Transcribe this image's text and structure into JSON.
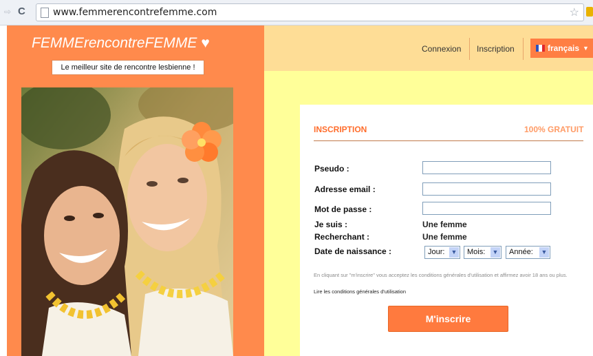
{
  "browser": {
    "url": "www.femmerencontrefemme.com",
    "star_icon": "star-icon",
    "reload_icon": "reload-icon"
  },
  "header": {
    "logo": "FEMMErencontreFEMME",
    "logo_heart": "♥",
    "tagline": "Le meilleur site de rencontre lesbienne !",
    "nav": {
      "login": "Connexion",
      "signup": "Inscription",
      "language": "français"
    }
  },
  "form": {
    "title": "INSCRIPTION",
    "badge": "100% GRATUIT",
    "fields": {
      "pseudo_label": "Pseudo :",
      "pseudo_value": "",
      "email_label": "Adresse email :",
      "email_value": "",
      "password_label": "Mot de passe :",
      "password_value": "",
      "iam_label": "Je suis :",
      "iam_value": "Une femme",
      "seeking_label": "Recherchant :",
      "seeking_value": "Une femme",
      "birthdate_label": "Date de naissance :",
      "day": "Jour:",
      "month": "Mois:",
      "year": "Année:"
    },
    "legal": "En cliquant sur \"m'inscrire\" vous acceptez les conditions générales d'utilisation et affirmez avoir 18 ans ou plus.",
    "terms_link": "Lire les conditions générales d'utilisation",
    "submit": "M'inscrire"
  },
  "colors": {
    "brand_orange": "#ff8a4c",
    "nav_bar": "#fedd96",
    "page_yellow": "#ffff99",
    "title_orange": "#ff6d2c"
  }
}
